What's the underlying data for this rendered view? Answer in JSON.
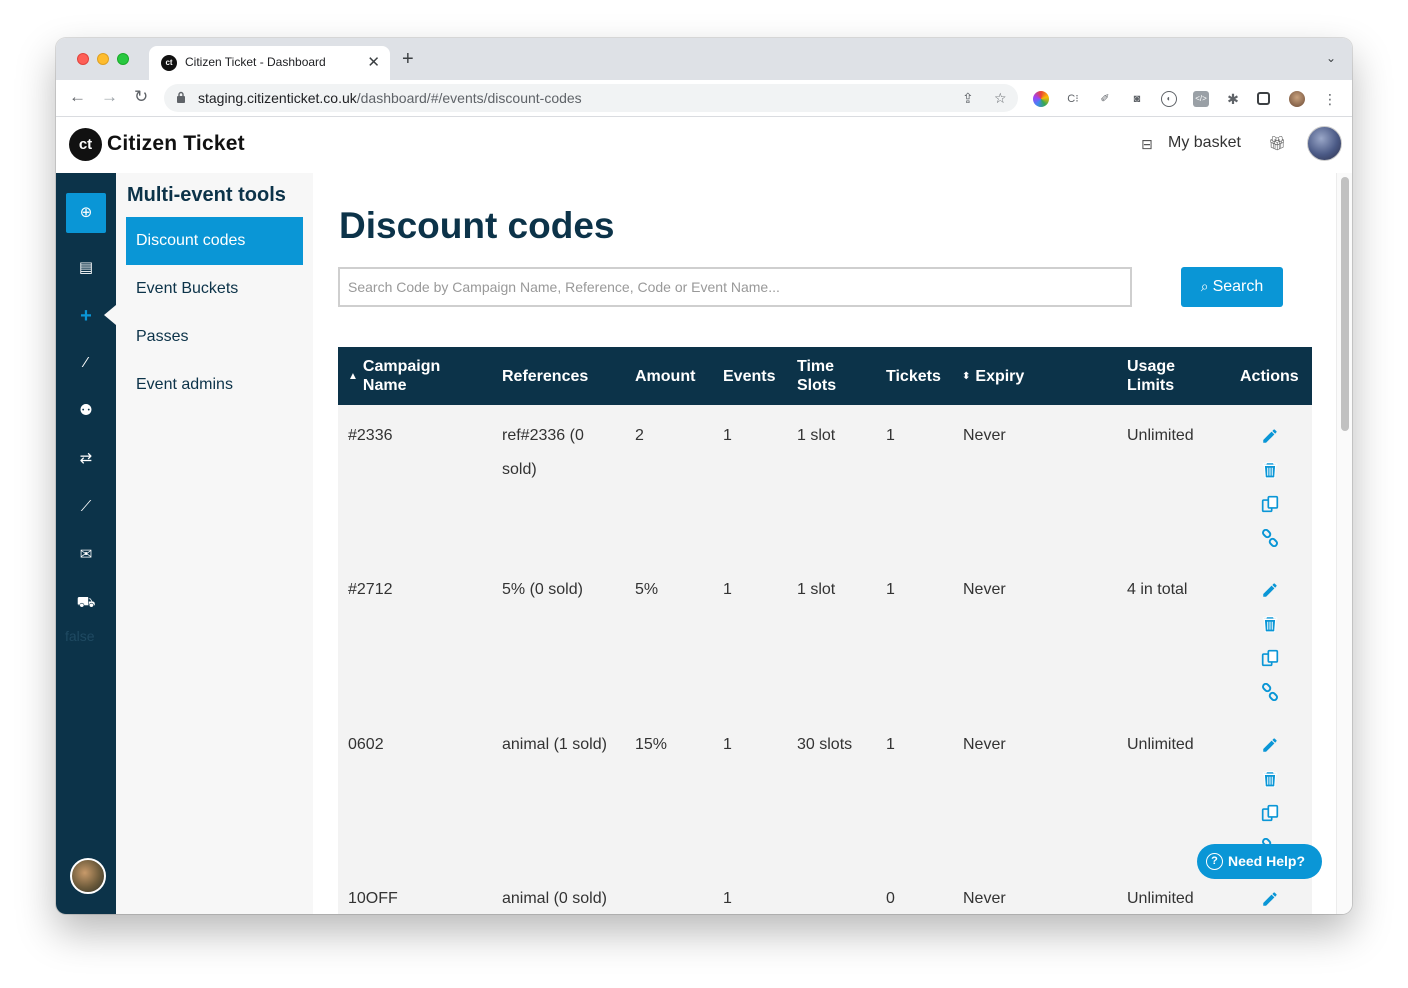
{
  "browser": {
    "tab_title": "Citizen Ticket - Dashboard",
    "tab_favicon": "ct",
    "tab_close": "✕",
    "new_tab": "+",
    "url_host": "staging.citizenticket.co.uk",
    "url_path": "/dashboard/#/events/discount-codes"
  },
  "header": {
    "logo_mark": "ct",
    "logo_text": "Citizen Ticket",
    "basket_label": "My basket"
  },
  "rail": {
    "icons": [
      "plus-circle-icon",
      "list-icon",
      "plus-icon",
      "magic-wand-icon",
      "users-icon",
      "transfer-icon",
      "chart-icon",
      "envelope-icon",
      "truck-icon"
    ],
    "stray_text": "false"
  },
  "subnav": {
    "title": "Multi-event tools",
    "items": [
      {
        "label": "Discount codes",
        "active": true
      },
      {
        "label": "Event Buckets",
        "active": false
      },
      {
        "label": "Passes",
        "active": false
      },
      {
        "label": "Event admins",
        "active": false
      }
    ]
  },
  "main": {
    "title": "Discount codes",
    "search_placeholder": "Search Code by Campaign Name, Reference, Code or Event Name...",
    "search_button": "Search"
  },
  "table": {
    "headers": [
      "Campaign Name",
      "References",
      "Amount",
      "Events",
      "Time Slots",
      "Tickets",
      "Expiry",
      "Usage Limits",
      "Actions"
    ],
    "rows": [
      {
        "campaign": "#2336",
        "references": "ref#2336 (0 sold)",
        "amount": "2",
        "events": "1",
        "time_slots": "1 slot",
        "tickets": "1",
        "expiry": "Never",
        "usage": "Unlimited"
      },
      {
        "campaign": "#2712",
        "references": "5% (0 sold)",
        "amount": "5%",
        "events": "1",
        "time_slots": "1 slot",
        "tickets": "1",
        "expiry": "Never",
        "usage": "4 in total"
      },
      {
        "campaign": "0602",
        "references": "animal (1 sold)",
        "amount": "15%",
        "events": "1",
        "time_slots": "30 slots",
        "tickets": "1",
        "expiry": "Never",
        "usage": "Unlimited"
      },
      {
        "campaign": "10OFF",
        "references": "animal (0 sold)",
        "amount": "",
        "events": "1",
        "time_slots": "",
        "tickets": "0",
        "expiry": "Never",
        "usage": "Unlimited"
      }
    ]
  },
  "help_button": "Need Help?",
  "colors": {
    "navy": "#0c3349",
    "accent": "#0a96d6"
  }
}
